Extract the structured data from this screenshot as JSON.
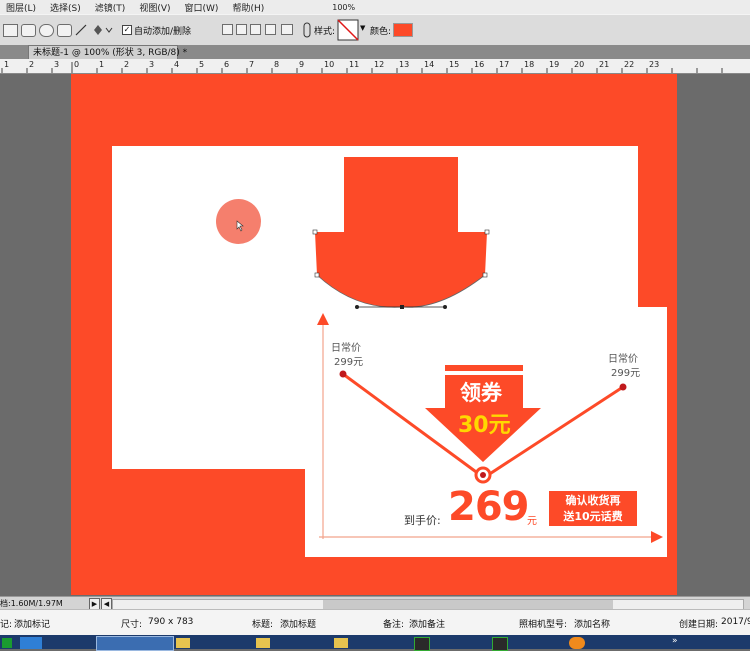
{
  "menu": {
    "items": [
      "图层(L)",
      "选择(S)",
      "滤镜(T)",
      "视图(V)",
      "窗口(W)",
      "帮助(H)"
    ],
    "zoom": "100%"
  },
  "options": {
    "auto_add_delete": "自动添加/删除",
    "style_label": "样式:",
    "color_label": "颜色:",
    "color_value": "#fd4a28"
  },
  "document": {
    "tab_title": "未标题-1 @ 100% (形状 3, RGB/8) *",
    "ruler_marks": [
      "1",
      "2",
      "3",
      "1",
      "0",
      "1",
      "2",
      "3",
      "4",
      "5",
      "6",
      "7",
      "8",
      "9",
      "10",
      "11",
      "12",
      "13",
      "14",
      "15",
      "16",
      "17",
      "18",
      "19",
      "20",
      "21",
      "22",
      "23"
    ]
  },
  "design": {
    "colors": {
      "accent": "#fd4a28",
      "dark_red": "#d62a10",
      "yellow": "#ffd800",
      "white": "#ffffff"
    },
    "left_label": "日常价",
    "left_price": "299元",
    "right_label": "日常价",
    "right_price": "299元",
    "coupon_title": "领券",
    "coupon_value": "30元",
    "final_label": "到手价:",
    "final_price": "269",
    "final_unit": "元",
    "promo_line1": "确认收货再",
    "promo_line2": "送10元话费"
  },
  "status": {
    "doc_size": "档:1.60M/1.97M"
  },
  "file_info": {
    "mark_label": "记:",
    "mark_value": "添加标记",
    "size_label": "尺寸:",
    "size_value": "790 x 783",
    "title_label": "标题:",
    "title_value": "添加标题",
    "note_label": "备注:",
    "note_value": "添加备注",
    "camera_label": "照相机型号:",
    "camera_value": "添加名称",
    "created_label": "创建日期:",
    "created_value": "2017/9"
  }
}
